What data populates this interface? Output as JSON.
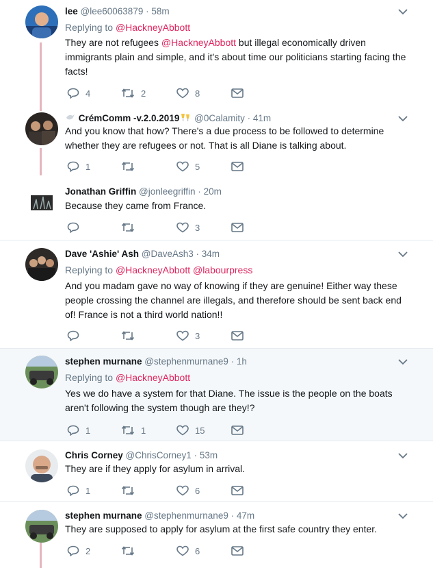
{
  "colors": {
    "mention": "#e0245e",
    "muted": "#657786",
    "thread": "#e5b5bd",
    "highlight_bg": "#f5f8fa"
  },
  "tweets": [
    {
      "name": "lee",
      "handle": "@lee60063879",
      "sep": "·",
      "time": "58m",
      "replying_label": "Replying to",
      "replying_to": [
        "@HackneyAbbott"
      ],
      "text_pre": "They are not refugees ",
      "text_mention": "@HackneyAbbott",
      "text_post": " but illegal economically driven immigrants plain and simple, and it's about time our politicians starting facing the facts!",
      "replies": "4",
      "retweets": "2",
      "likes": "8"
    },
    {
      "name": "CrémComm -v.2.0.2019",
      "handle": "@0Calamity",
      "sep": "·",
      "time": "41m",
      "text": "And you know that how? There's a due process to be followed to determine whether they are refugees or not.  That is all Diane is talking about.",
      "replies": "1",
      "retweets": "",
      "likes": "5"
    },
    {
      "name": "Jonathan Griffin",
      "handle": "@jonleegriffin",
      "sep": "·",
      "time": "20m",
      "text": "Because they came from France.",
      "replies": "",
      "retweets": "",
      "likes": "3"
    },
    {
      "name": "Dave 'Ashie' Ash",
      "handle": "@DaveAsh3",
      "sep": "·",
      "time": "34m",
      "replying_label": "Replying to",
      "replying_to": [
        "@HackneyAbbott",
        "@labourpress"
      ],
      "text": "And you madam gave no way of knowing if they are genuine! Either way these people crossing the channel are illegals, and therefore should be sent back end of! France is not a third world nation!!",
      "replies": "",
      "retweets": "",
      "likes": "3"
    },
    {
      "name": "stephen murnane",
      "handle": "@stephenmurnane9",
      "sep": "·",
      "time": "1h",
      "replying_label": "Replying to",
      "replying_to": [
        "@HackneyAbbott"
      ],
      "text": "Yes we do have a system for that Diane.  The issue is the people on the boats aren't following the system though are they!?",
      "replies": "1",
      "retweets": "1",
      "likes": "15"
    },
    {
      "name": "Chris Corney",
      "handle": "@ChrisCorney1",
      "sep": "·",
      "time": "53m",
      "text": "They are if they apply for asylum in arrival.",
      "replies": "1",
      "retweets": "",
      "likes": "6"
    },
    {
      "name": "stephen murnane",
      "handle": "@stephenmurnane9",
      "sep": "·",
      "time": "47m",
      "text": "They are supposed to apply for asylum at the first safe country they enter.",
      "replies": "2",
      "retweets": "",
      "likes": "6"
    }
  ]
}
